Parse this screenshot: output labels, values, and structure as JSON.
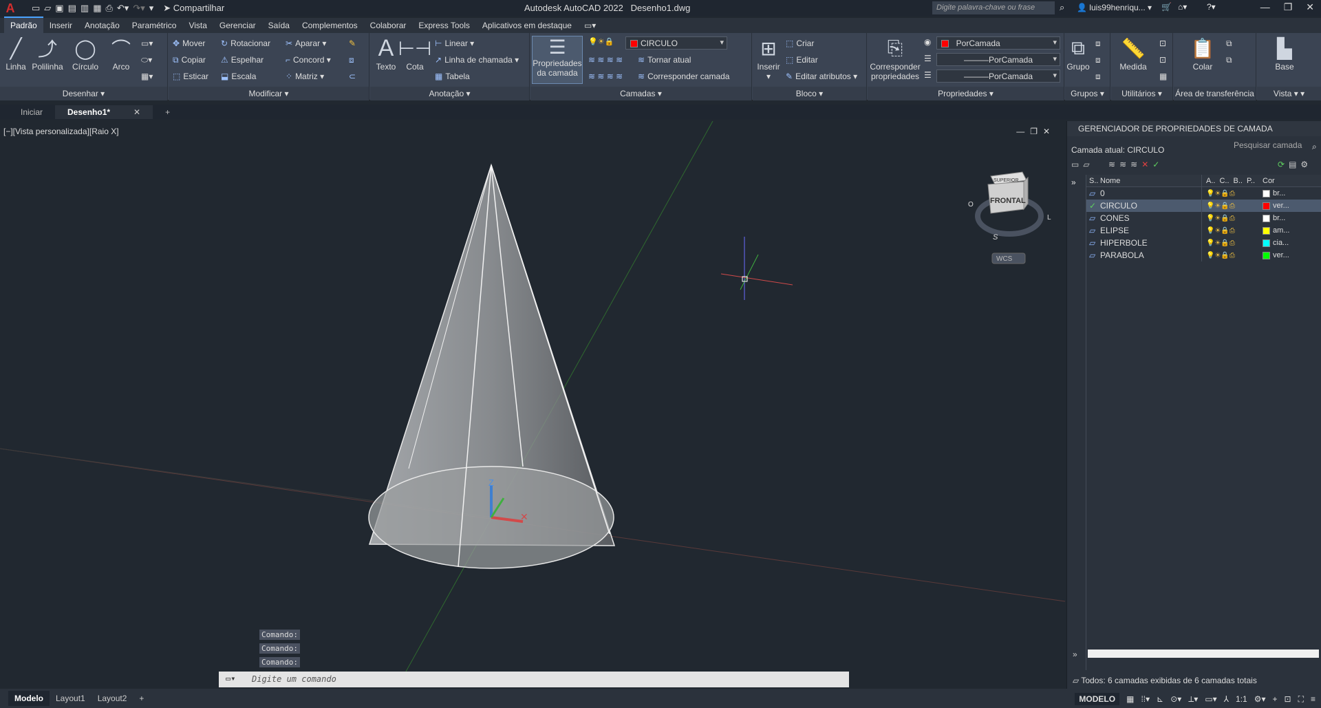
{
  "app": {
    "logo": "A",
    "title": "Autodesk AutoCAD 2022",
    "file": "Desenho1.dwg",
    "share_label": "Compartilhar",
    "search_placeholder": "Digite palavra-chave ou frase",
    "user": "luis99henriqu..."
  },
  "ribbon_tabs": [
    "Padrão",
    "Inserir",
    "Anotação",
    "Paramétrico",
    "Vista",
    "Gerenciar",
    "Saída",
    "Complementos",
    "Colaborar",
    "Express Tools",
    "Aplicativos em destaque"
  ],
  "draw_panel": {
    "title": "Desenhar",
    "linha": "Linha",
    "polilinha": "Polilinha",
    "circulo": "Círculo",
    "arco": "Arco"
  },
  "modify_panel": {
    "title": "Modificar",
    "mover": "Mover",
    "rotacionar": "Rotacionar",
    "aparar": "Aparar",
    "copiar": "Copiar",
    "espelhar": "Espelhar",
    "concord": "Concord",
    "esticar": "Esticar",
    "escala": "Escala",
    "matriz": "Matriz"
  },
  "annotation_panel": {
    "title": "Anotação",
    "texto": "Texto",
    "cota": "Cota",
    "linear": "Linear",
    "linha_chamada": "Linha de chamada",
    "tabela": "Tabela"
  },
  "layers_panel": {
    "title": "Camadas",
    "props_line1": "Propriedades",
    "props_line2": "da camada",
    "current_layer": "CIRCULO",
    "tornar_atual": "Tornar atual",
    "corresponder_camada": "Corresponder camada"
  },
  "block_panel": {
    "title": "Bloco",
    "inserir": "Inserir",
    "criar": "Criar",
    "editar": "Editar",
    "editar_atributos": "Editar atributos"
  },
  "properties_panel": {
    "title": "Propriedades",
    "corresponder_line1": "Corresponder",
    "corresponder_line2": "propriedades",
    "color": "PorCamada",
    "linetype": "PorCamada",
    "lineweight": "PorCamada"
  },
  "groups_panel": {
    "title": "Grupos",
    "grupo": "Grupo"
  },
  "utilities_panel": {
    "title": "Utilitários",
    "medida": "Medida"
  },
  "clipboard_panel": {
    "title": "Área de transferência",
    "colar": "Colar"
  },
  "view_panel": {
    "title": "Vista",
    "base": "Base"
  },
  "doc_tabs": {
    "start": "Iniciar",
    "current": "Desenho1*"
  },
  "viewport": {
    "label": "[−][Vista personalizada][Raio X]",
    "viewcube_top": "SUPERIOR",
    "viewcube_front": "FRONTAL",
    "compass_o": "O",
    "compass_l": "L",
    "compass_s": "S",
    "wcs": "WCS",
    "z_label": "Z"
  },
  "command": {
    "history": [
      "Comando:",
      "Comando:",
      "Comando:"
    ],
    "placeholder": "Digite um comando"
  },
  "layout_tabs": [
    "Modelo",
    "Layout1",
    "Layout2"
  ],
  "status": {
    "model": "MODELO",
    "scale": "1:1"
  },
  "layer_manager": {
    "title": "GERENCIADOR DE PROPRIEDADES DE CAMADA",
    "current": "Camada atual: CIRCULO",
    "search": "Pesquisar camada",
    "columns": {
      "s": "S..",
      "nome": "Nome",
      "a": "A..",
      "c": "C..",
      "b": "B..",
      "p": "P..",
      "cor": "Cor"
    },
    "layers": [
      {
        "name": "0",
        "color_name": "br...",
        "color": "#ffffff"
      },
      {
        "name": "CIRCULO",
        "color_name": "ver...",
        "color": "#ff0000"
      },
      {
        "name": "CONES",
        "color_name": "br...",
        "color": "#ffffff"
      },
      {
        "name": "ELIPSE",
        "color_name": "am...",
        "color": "#ffff00"
      },
      {
        "name": "HIPERBOLE",
        "color_name": "cia...",
        "color": "#00ffff"
      },
      {
        "name": "PARABOLA",
        "color_name": "ver...",
        "color": "#00ff00"
      }
    ],
    "footer": "Todos: 6 camadas exibidas de 6 camadas totais"
  }
}
